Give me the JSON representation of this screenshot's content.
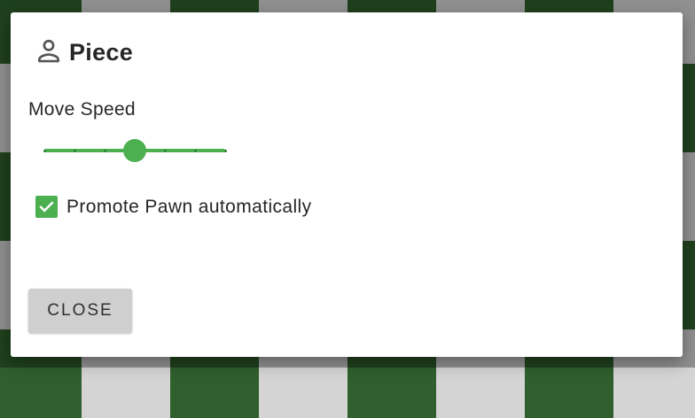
{
  "dialog": {
    "title": "Piece",
    "title_icon": "person-icon",
    "speed_label": "Move Speed",
    "speed_slider": {
      "min": 0,
      "max": 6,
      "value": 3,
      "steps": 6
    },
    "promote_label": "Promote Pawn automatically",
    "promote_checked": true,
    "close_label": "CLOSE"
  },
  "colors": {
    "accent": "#4caf50",
    "board_light": "#d4d4d4",
    "board_dark": "#2f5f2c",
    "close_button": "#cfcfcf"
  }
}
